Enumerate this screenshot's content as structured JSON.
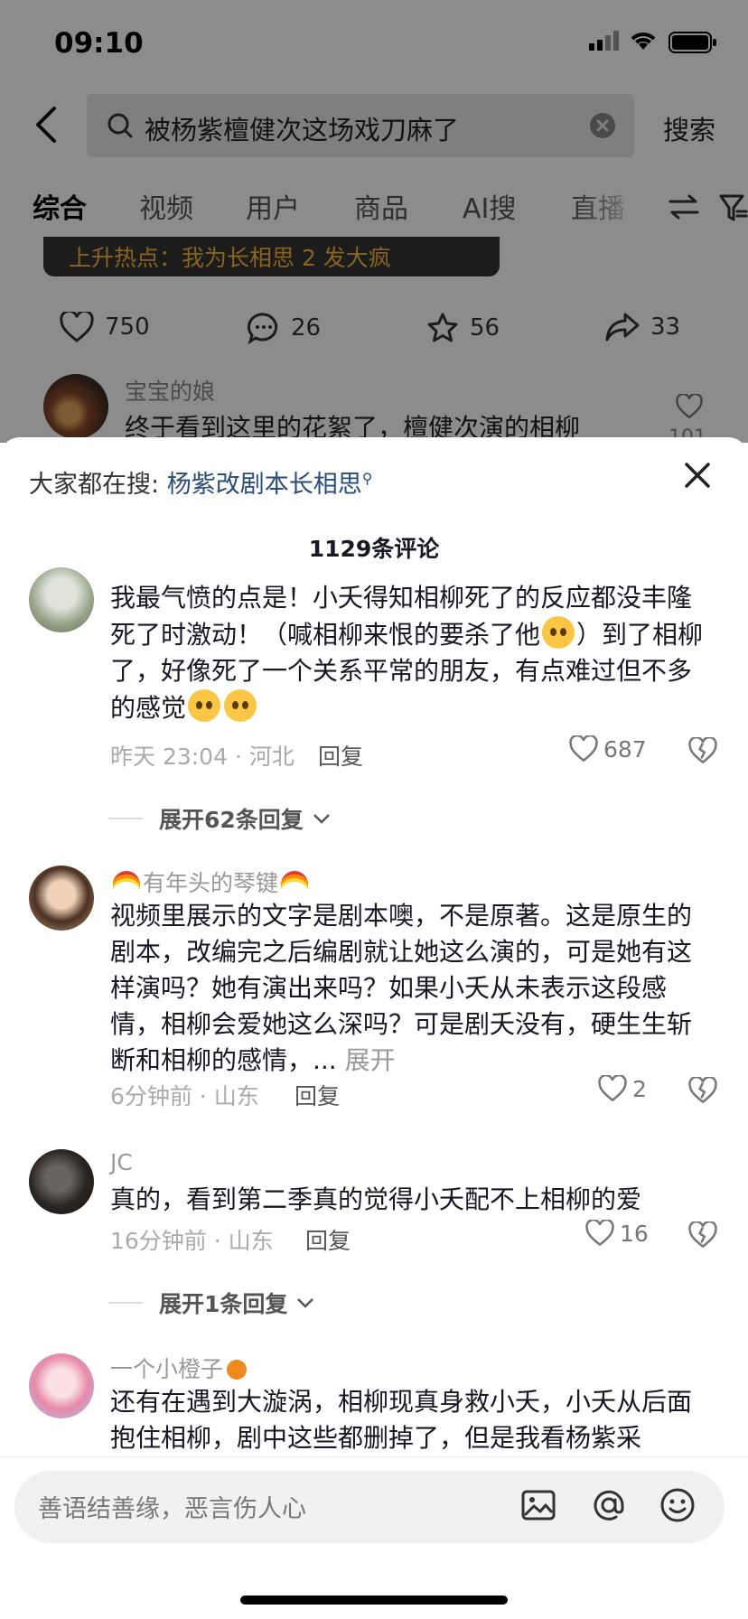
{
  "status_bar": {
    "time": "09:10"
  },
  "search": {
    "query": "被杨紫檀健次这场戏刀麻了",
    "button_label": "搜索"
  },
  "tabs": [
    {
      "label": "综合",
      "active": true
    },
    {
      "label": "视频",
      "active": false
    },
    {
      "label": "用户",
      "active": false
    },
    {
      "label": "商品",
      "active": false
    },
    {
      "label": "AI搜",
      "active": false
    },
    {
      "label": "直播",
      "active": false
    }
  ],
  "background_post": {
    "hot_banner": "上升热点：我为长相思 2 发大疯",
    "stats": {
      "likes": "750",
      "comments": "26",
      "favorites": "56",
      "shares": "33"
    },
    "comment_user": "宝宝的娘",
    "comment_text": "终于看到这里的花絮了，檀健次演的相柳",
    "comment_likes": "101"
  },
  "sheet": {
    "trending_prefix": "大家都在搜:",
    "trending_query": "杨紫改剧本长相思",
    "comment_count": "1129条评论",
    "comments": [
      {
        "username": "",
        "text": "我最气愤的点是！小夭得知相柳死了的反应都没丰隆死了时激动！（喊相柳来恨的要杀了他",
        "text_tail": "）到了相柳了，好像死了一个关系平常的朋友，有点难过但不多的感觉",
        "time_location": "昨天 23:04 · 河北",
        "reply_label": "回复",
        "likes": "687",
        "expand_label": "展开62条回复"
      },
      {
        "username": "有年头的琴键",
        "text": "视频里展示的文字是剧本噢，不是原著。这是原生的剧本，改编完之后编剧就让她这么演的，可是她有这样演吗？她有演出来吗？如果小夭从未表示这段感情，相柳会爱她这么深吗？可是剧夭没有，硬生生斩断和相柳的感情，...",
        "more_label": "展开",
        "time_location": "6分钟前 · 山东",
        "reply_label": "回复",
        "likes": "2"
      },
      {
        "username": "JC",
        "text": "真的，看到第二季真的觉得小夭配不上相柳的爱",
        "time_location": "16分钟前 · 山东",
        "reply_label": "回复",
        "likes": "16",
        "expand_label": "展开1条回复"
      },
      {
        "username": "一个小橙子",
        "text": "还有在遇到大漩涡，相柳现真身救小夭，小夭从后面抱住相柳，剧中这些都删掉了，但是我看杨紫采"
      }
    ],
    "input_placeholder": "善语结善缘，恶言伤人心"
  },
  "icons": [
    "back-icon",
    "search-icon",
    "clear-icon",
    "sort-icon",
    "filter-icon",
    "heart-icon",
    "comment-icon",
    "star-icon",
    "share-icon",
    "close-icon",
    "dislike-icon",
    "chevron-down-icon",
    "image-icon",
    "at-icon",
    "emoji-icon"
  ],
  "colors": {
    "link": "#2a4d78",
    "hot_banner_text": "#f4b73c",
    "overlay": "rgba(0,0,0,0.45)"
  }
}
